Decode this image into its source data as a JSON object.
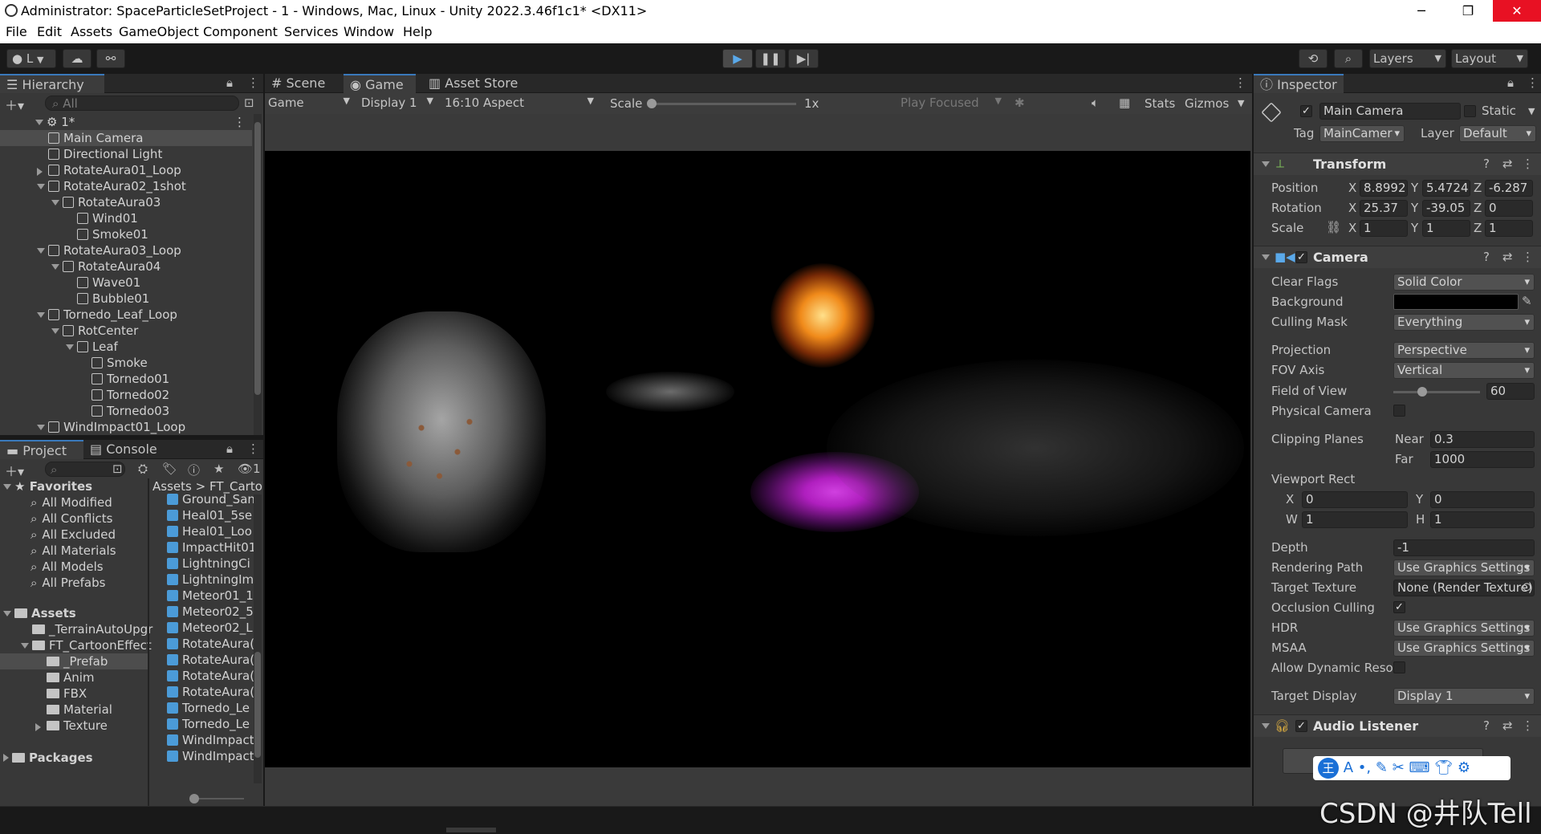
{
  "window": {
    "title": "Administrator: SpaceParticleSetProject - 1 - Windows, Mac, Linux - Unity 2022.3.46f1c1* <DX11>",
    "minimize": "─",
    "restore": "❐",
    "close": "✕"
  },
  "menu": [
    "File",
    "Edit",
    "Assets",
    "GameObject",
    "Component",
    "Services",
    "Window",
    "Help"
  ],
  "toolbar": {
    "account_label": "L",
    "layers_label": "Layers",
    "layout_label": "Layout"
  },
  "hierarchy": {
    "tab": "Hierarchy",
    "search_placeholder": "All",
    "scene": "1*",
    "items": [
      {
        "label": "Main Camera",
        "indent": 0,
        "expand": ""
      },
      {
        "label": "Directional Light",
        "indent": 0,
        "expand": ""
      },
      {
        "label": "RotateAura01_Loop",
        "indent": 0,
        "expand": "collapsed"
      },
      {
        "label": "RotateAura02_1shot",
        "indent": 0,
        "expand": "expanded"
      },
      {
        "label": "RotateAura03",
        "indent": 1,
        "expand": "expanded"
      },
      {
        "label": "Wind01",
        "indent": 2,
        "expand": ""
      },
      {
        "label": "Smoke01",
        "indent": 2,
        "expand": ""
      },
      {
        "label": "RotateAura03_Loop",
        "indent": 0,
        "expand": "expanded"
      },
      {
        "label": "RotateAura04",
        "indent": 1,
        "expand": "expanded"
      },
      {
        "label": "Wave01",
        "indent": 2,
        "expand": ""
      },
      {
        "label": "Bubble01",
        "indent": 2,
        "expand": ""
      },
      {
        "label": "Tornedo_Leaf_Loop",
        "indent": 0,
        "expand": "expanded"
      },
      {
        "label": "RotCenter",
        "indent": 1,
        "expand": "expanded"
      },
      {
        "label": "Leaf",
        "indent": 2,
        "expand": "expanded"
      },
      {
        "label": "Smoke",
        "indent": 3,
        "expand": ""
      },
      {
        "label": "Tornedo01",
        "indent": 3,
        "expand": ""
      },
      {
        "label": "Tornedo02",
        "indent": 3,
        "expand": ""
      },
      {
        "label": "Tornedo03",
        "indent": 3,
        "expand": ""
      },
      {
        "label": "WindImpact01_Loop",
        "indent": 0,
        "expand": "expanded"
      }
    ]
  },
  "project": {
    "tab_project": "Project",
    "tab_console": "Console",
    "favorites_title": "Favorites",
    "favorites": [
      "All Modified",
      "All Conflicts",
      "All Excluded",
      "All Materials",
      "All Models",
      "All Prefabs"
    ],
    "assets_title": "Assets",
    "assets_tree": [
      {
        "label": "_TerrainAutoUpgr",
        "indent": 1,
        "expand": ""
      },
      {
        "label": "FT_CartoonEffect",
        "indent": 1,
        "expand": "expanded"
      },
      {
        "label": "_Prefab",
        "indent": 2,
        "expand": ""
      },
      {
        "label": "Anim",
        "indent": 2,
        "expand": ""
      },
      {
        "label": "FBX",
        "indent": 2,
        "expand": ""
      },
      {
        "label": "Material",
        "indent": 2,
        "expand": ""
      },
      {
        "label": "Texture",
        "indent": 2,
        "expand": "collapsed"
      }
    ],
    "packages_title": "Packages",
    "breadcrumb_root": "Assets",
    "breadcrumb_sep": ">",
    "breadcrumb_folder": "FT_Carto",
    "files": [
      "Ground_San",
      "Heal01_5se",
      "Heal01_Loo",
      "ImpactHit01",
      "LightningCi",
      "LightningIm",
      "Meteor01_1",
      "Meteor02_5",
      "Meteor02_L",
      "RotateAura(",
      "RotateAura(",
      "RotateAura(",
      "RotateAura(",
      "Tornedo_Le",
      "Tornedo_Le",
      "WindImpact",
      "WindImpact"
    ],
    "hidden_count": "1"
  },
  "game_view": {
    "tab_scene": "Scene",
    "tab_game": "Game",
    "tab_store": "Asset Store",
    "game_dropdown": "Game",
    "display_dropdown": "Display 1",
    "aspect_dropdown": "16:10 Aspect",
    "scale_label": "Scale",
    "scale_value": "1x",
    "scale_fraction": 0.0,
    "play_mode": "Play Focused",
    "stats": "Stats",
    "gizmos": "Gizmos"
  },
  "inspector": {
    "tab": "Inspector",
    "object_name": "Main Camera",
    "static_label": "Static",
    "tag_label": "Tag",
    "tag_value": "MainCamer",
    "layer_label": "Layer",
    "layer_value": "Default",
    "transform": {
      "title": "Transform",
      "position_label": "Position",
      "rotation_label": "Rotation",
      "scale_label": "Scale",
      "x": "X",
      "y": "Y",
      "z": "Z",
      "position": [
        "8.8992",
        "5.4724",
        "-6.287"
      ],
      "rotation": [
        "25.37",
        "-39.05",
        "0"
      ],
      "scale": [
        "1",
        "1",
        "1"
      ]
    },
    "camera": {
      "title": "Camera",
      "clear_flags_label": "Clear Flags",
      "clear_flags": "Solid Color",
      "background_label": "Background",
      "background_color": "#000000",
      "culling_mask_label": "Culling Mask",
      "culling_mask": "Everything",
      "projection_label": "Projection",
      "projection": "Perspective",
      "fov_axis_label": "FOV Axis",
      "fov_axis": "Vertical",
      "fov_label": "Field of View",
      "fov_value": "60",
      "fov_fraction": 0.33,
      "physical_label": "Physical Camera",
      "clipping_label": "Clipping Planes",
      "near_label": "Near",
      "near": "0.3",
      "far_label": "Far",
      "far": "1000",
      "viewport_label": "Viewport Rect",
      "vx_label": "X",
      "vx": "0",
      "vy_label": "Y",
      "vy": "0",
      "vw_label": "W",
      "vw": "1",
      "vh_label": "H",
      "vh": "1",
      "depth_label": "Depth",
      "depth": "-1",
      "rendering_path_label": "Rendering Path",
      "rendering_path": "Use Graphics Settings",
      "target_texture_label": "Target Texture",
      "target_texture": "None (Render Texture)",
      "occlusion_label": "Occlusion Culling",
      "hdr_label": "HDR",
      "hdr": "Use Graphics Settings",
      "msaa_label": "MSAA",
      "msaa": "Use Graphics Settings",
      "dynres_label": "Allow Dynamic Reso",
      "target_display_label": "Target Display",
      "target_display": "Display 1"
    },
    "audio_listener": {
      "title": "Audio Listener"
    }
  },
  "watermark": "CSDN @井队Tell",
  "colors": {
    "accent": "#3a79bb",
    "selection": "#2c5d87",
    "panel": "#383838",
    "magic_purple": "#b01fbf",
    "fire": "#f08a1a"
  }
}
